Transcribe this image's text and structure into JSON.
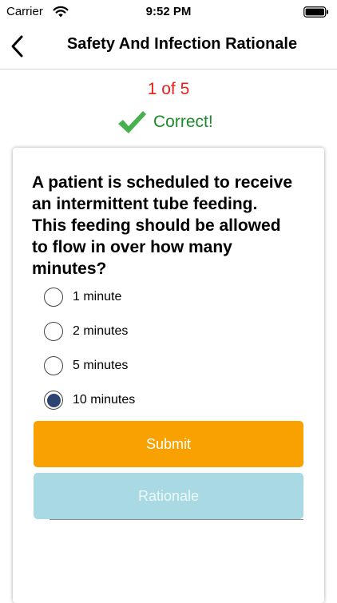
{
  "status_bar": {
    "carrier": "Carrier",
    "time": "9:52 PM",
    "wifi_icon": "wifi-icon",
    "battery_icon": "battery-icon"
  },
  "nav": {
    "back_icon": "chevron-left-icon",
    "title": "Safety And Infection Rationale"
  },
  "progress": {
    "text": "1 of 5",
    "color": "#e8201a"
  },
  "result": {
    "icon": "checkmark-icon",
    "text": "Correct!",
    "color": "#1d8a2b"
  },
  "question": {
    "text": "A patient is scheduled to receive an intermittent tube feeding. This feeding should be allowed to flow in over how many minutes?"
  },
  "options": [
    {
      "label": "1 minute",
      "selected": false
    },
    {
      "label": "2 minutes",
      "selected": false
    },
    {
      "label": "5 minutes",
      "selected": false
    },
    {
      "label": "10 minutes",
      "selected": true
    }
  ],
  "buttons": {
    "submit_label": "Submit",
    "submit_color": "#f8a100",
    "rationale_label": "Rationale",
    "rationale_color": "#a9d9e3"
  }
}
